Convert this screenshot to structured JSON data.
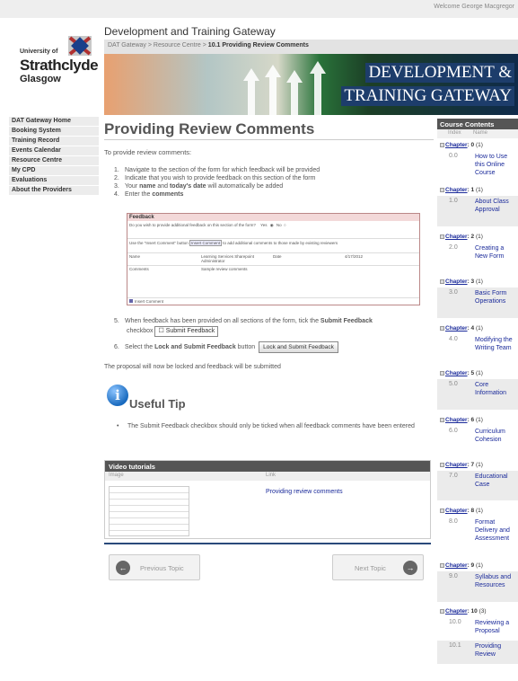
{
  "header": {
    "welcome": "Welcome George Macgregor",
    "logo": {
      "line1": "University of",
      "line2": "Strathclyde",
      "line3": "Glasgow"
    },
    "site_title": "Development and Training Gateway",
    "breadcrumb": {
      "parent": "DAT Gateway > Resource Centre > ",
      "current": "10.1 Providing Review Comments"
    },
    "banner": {
      "line1": "DEVELOPMENT &",
      "line2": "TRAINING GATEWAY"
    }
  },
  "sidenav": [
    "DAT Gateway Home",
    "Booking System",
    "Training Record",
    "Events Calendar",
    "Resource Centre",
    "My CPD",
    "Evaluations",
    "About the Providers"
  ],
  "main": {
    "title": "Providing Review Comments",
    "intro": "To provide review comments:",
    "steps": [
      {
        "n": "1.",
        "text": "Navigate to the section of the form for which feedback will be provided"
      },
      {
        "n": "2.",
        "text": "Indicate that you wish to provide feedback on this section of the form"
      },
      {
        "n": "3.",
        "pre": "Your ",
        "b1": "name",
        "mid": " and ",
        "b2": "today's date",
        "post": " will automatically be added"
      },
      {
        "n": "4.",
        "pre": "Enter the ",
        "b1": "comments"
      }
    ],
    "form": {
      "heading": "Feedback",
      "question": "Do you wish to provide additional feedback on this section of the form?",
      "yes": "Yes",
      "no": "No",
      "use_pre": "Use the \"Insert Comment\" button",
      "insert_btn": "Insert Comment",
      "use_post": "to add additional comments to those made by existing reviewers",
      "name_label": "Name",
      "name_value": "Learning Services Sharepoint Administrator",
      "date_label": "Date",
      "date_value": "4/17/2012",
      "comments_label": "Comments",
      "comments_value": "Sample review comments",
      "insert_footer": "Insert Comment"
    },
    "step5": {
      "n": "5.",
      "pre": "When feedback has been provided on all sections of the form, tick the ",
      "b": "Submit Feedback",
      "post": " checkbox",
      "checkbox_label": "Submit Feedback"
    },
    "step6": {
      "n": "6.",
      "pre": "Select the ",
      "b": "Lock and Submit Feedback",
      "post": " button",
      "button_label": "Lock and Submit Feedback"
    },
    "locked_text": "The proposal will now be locked and feedback will be submitted",
    "tip": {
      "title": "Useful Tip",
      "text": "The Submit Feedback checkbox should only be ticked when all feedback comments have been entered"
    },
    "video": {
      "heading": "Video tutorials",
      "col_image": "Image",
      "col_link": "Link",
      "link_text": "Providing review comments"
    },
    "pager": {
      "prev": "Previous Topic",
      "next": "Next Topic"
    }
  },
  "contents": {
    "heading": "Course Contents",
    "col_index": "Index",
    "col_name": "Name",
    "chapters": [
      {
        "label": "Chapter",
        "num": ": 0",
        "count": " (1)",
        "idx": "0.0",
        "name": "How to Use this Online Course"
      },
      {
        "label": "Chapter",
        "num": ": 1",
        "count": " (1)",
        "idx": "1.0",
        "name": "About Class Approval"
      },
      {
        "label": "Chapter",
        "num": ": 2",
        "count": " (1)",
        "idx": "2.0",
        "name": "Creating a New Form"
      },
      {
        "label": "Chapter",
        "num": ": 3",
        "count": " (1)",
        "idx": "3.0",
        "name": "Basic Form Operations"
      },
      {
        "label": "Chapter",
        "num": ": 4",
        "count": " (1)",
        "idx": "4.0",
        "name": "Modifying the Writing Team"
      },
      {
        "label": "Chapter",
        "num": ": 5",
        "count": " (1)",
        "idx": "5.0",
        "name": "Core Information"
      },
      {
        "label": "Chapter",
        "num": ": 6",
        "count": " (1)",
        "idx": "6.0",
        "name": "Curriculum Cohesion"
      },
      {
        "label": "Chapter",
        "num": ": 7",
        "count": " (1)",
        "idx": "7.0",
        "name": "Educational Case"
      },
      {
        "label": "Chapter",
        "num": ": 8",
        "count": " (1)",
        "idx": "8.0",
        "name": "Format Delivery and Assessment"
      },
      {
        "label": "Chapter",
        "num": ": 9",
        "count": " (1)",
        "idx": "9.0",
        "name": "Syllabus and Resources"
      },
      {
        "label": "Chapter",
        "num": ": 10",
        "count": " (3)",
        "idx": "10.0",
        "name": "Reviewing a Proposal",
        "idx2": "10.1",
        "name2": "Providing Review"
      }
    ]
  }
}
